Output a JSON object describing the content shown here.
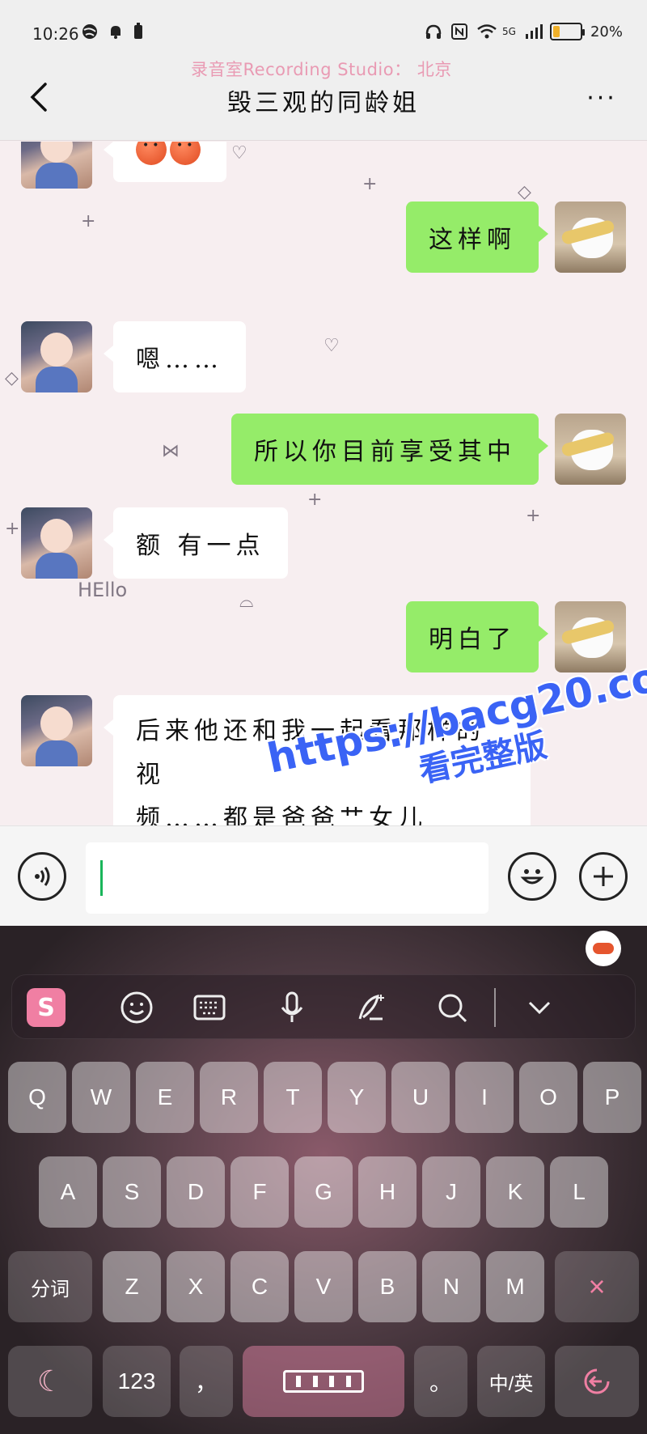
{
  "status_bar": {
    "time": "10:26",
    "network": "5G",
    "network2": "6",
    "battery": "20%",
    "battery_color": "#f0b02a"
  },
  "header": {
    "watermark": "录音室Recording Studio： 北京",
    "title": "毁三观的同龄姐",
    "more": "···"
  },
  "chat": {
    "messages": [
      {
        "side": "in",
        "text": ""
      },
      {
        "side": "out",
        "text": "这样啊"
      },
      {
        "side": "in",
        "text": "嗯……"
      },
      {
        "side": "out",
        "text": "所以你目前享受其中"
      },
      {
        "side": "in",
        "text": "额 有一点"
      },
      {
        "side": "out",
        "text": "明白了"
      },
      {
        "side": "in",
        "line1": "后来他还和我一起看那样的视",
        "line2": "频……都是爸爸艹女儿的……"
      }
    ],
    "deco_hello": "HEllo",
    "out_bubble_color": "#95ec69"
  },
  "watermark_overlay": {
    "url": "https://bacg20.com",
    "label": "看完整版"
  },
  "input_bar": {
    "voice_icon": "voice-icon",
    "emoji_icon": "smiley-icon",
    "plus_icon": "plus-icon"
  },
  "keyboard": {
    "row1": [
      "Q",
      "W",
      "E",
      "R",
      "T",
      "Y",
      "U",
      "I",
      "O",
      "P"
    ],
    "row2": [
      "A",
      "S",
      "D",
      "F",
      "G",
      "H",
      "J",
      "K",
      "L"
    ],
    "row3_left": "分词",
    "row3": [
      "Z",
      "X",
      "C",
      "V",
      "B",
      "N",
      "M"
    ],
    "row3_delete": "×",
    "row4": {
      "numbers": "123",
      "comma": "，",
      "period": "。",
      "lang": "中/英"
    },
    "accent_color": "#f07fa3"
  }
}
